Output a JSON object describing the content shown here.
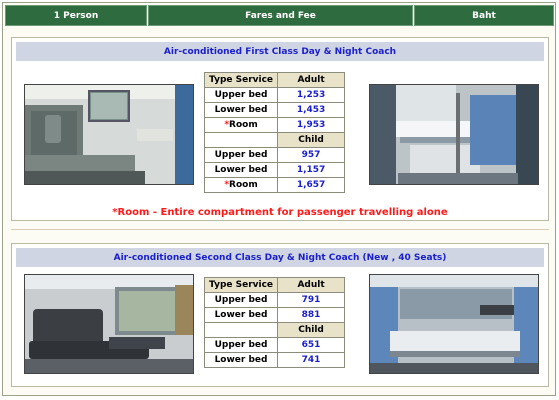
{
  "header": {
    "col1": "1 Person",
    "col2": "Fares and Fee",
    "col3": "Baht"
  },
  "first_class": {
    "title": "Air-conditioned First Class Day & Night Coach",
    "col_type": "Type Service",
    "col_adult": "Adult",
    "col_child": "Child",
    "adult_rows": [
      {
        "label": "Upper bed",
        "star": "",
        "value": "1,253"
      },
      {
        "label": "Lower bed",
        "star": "",
        "value": "1,453"
      },
      {
        "label": "Room",
        "star": "*",
        "value": "1,953"
      }
    ],
    "child_rows": [
      {
        "label": "Upper bed",
        "star": "",
        "value": "957"
      },
      {
        "label": "Lower bed",
        "star": "",
        "value": "1,157"
      },
      {
        "label": "Room",
        "star": "*",
        "value": "1,657"
      }
    ],
    "note": "*Room - Entire compartment for passenger travelling alone"
  },
  "second_class": {
    "title": "Air-conditioned Second Class Day & Night Coach (New , 40 Seats)",
    "col_type": "Type Service",
    "col_adult": "Adult",
    "col_child": "Child",
    "adult_rows": [
      {
        "label": "Upper bed",
        "value": "791"
      },
      {
        "label": "Lower bed",
        "value": "881"
      }
    ],
    "child_rows": [
      {
        "label": "Upper bed",
        "value": "651"
      },
      {
        "label": "Lower bed",
        "value": "741"
      }
    ]
  }
}
